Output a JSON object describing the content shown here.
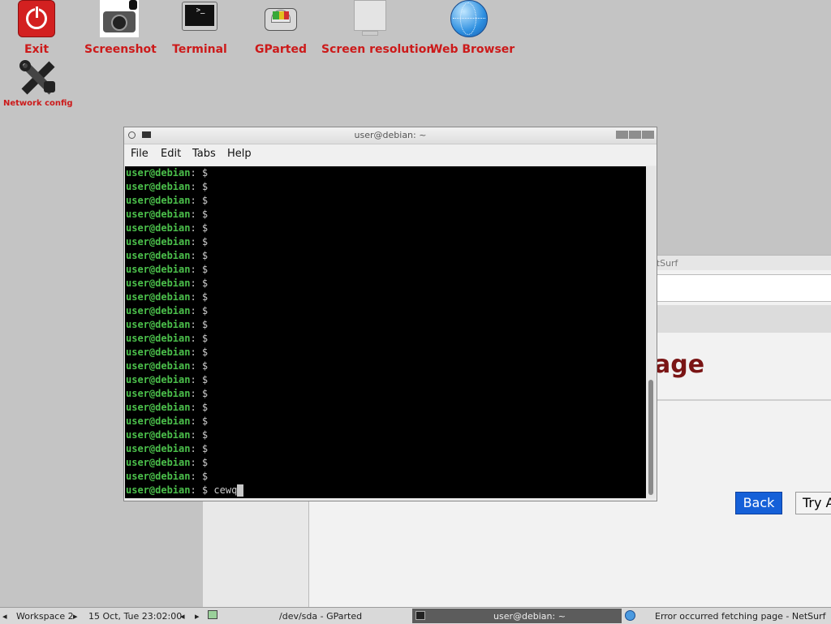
{
  "desktop": {
    "icons": [
      {
        "label": "Exit",
        "icon": "power-icon"
      },
      {
        "label": "Screenshot",
        "icon": "camera-icon"
      },
      {
        "label": "Terminal",
        "icon": "terminal-icon"
      },
      {
        "label": "GParted",
        "icon": "disk-icon"
      },
      {
        "label": "Screen resolution",
        "icon": "monitor-icon"
      },
      {
        "label": "Web Browser",
        "icon": "globe-icon"
      },
      {
        "label": "Network config",
        "icon": "tools-icon"
      }
    ]
  },
  "netsurf": {
    "title_fragment": "etSurf",
    "heading_fragment": "age",
    "back_label": "Back",
    "try_label": "Try A"
  },
  "terminal": {
    "title": "user@debian: ~",
    "menu": [
      "File",
      "Edit",
      "Tabs",
      "Help"
    ],
    "prompt_user": "user@debian",
    "prompt_rest": ": $",
    "empty_prompt_count": 23,
    "last_command": "cewq",
    "colors": {
      "prompt": "#4bc04b",
      "background": "#000000"
    }
  },
  "taskbar": {
    "workspace": "Workspace 2",
    "datetime": "15 Oct, Tue 23:02:00",
    "tasks": [
      {
        "label": "/dev/sda - GParted",
        "active": false
      },
      {
        "label": "user@debian: ~",
        "active": true
      },
      {
        "label": "Error occurred fetching page - NetSurf",
        "active": false
      }
    ]
  }
}
